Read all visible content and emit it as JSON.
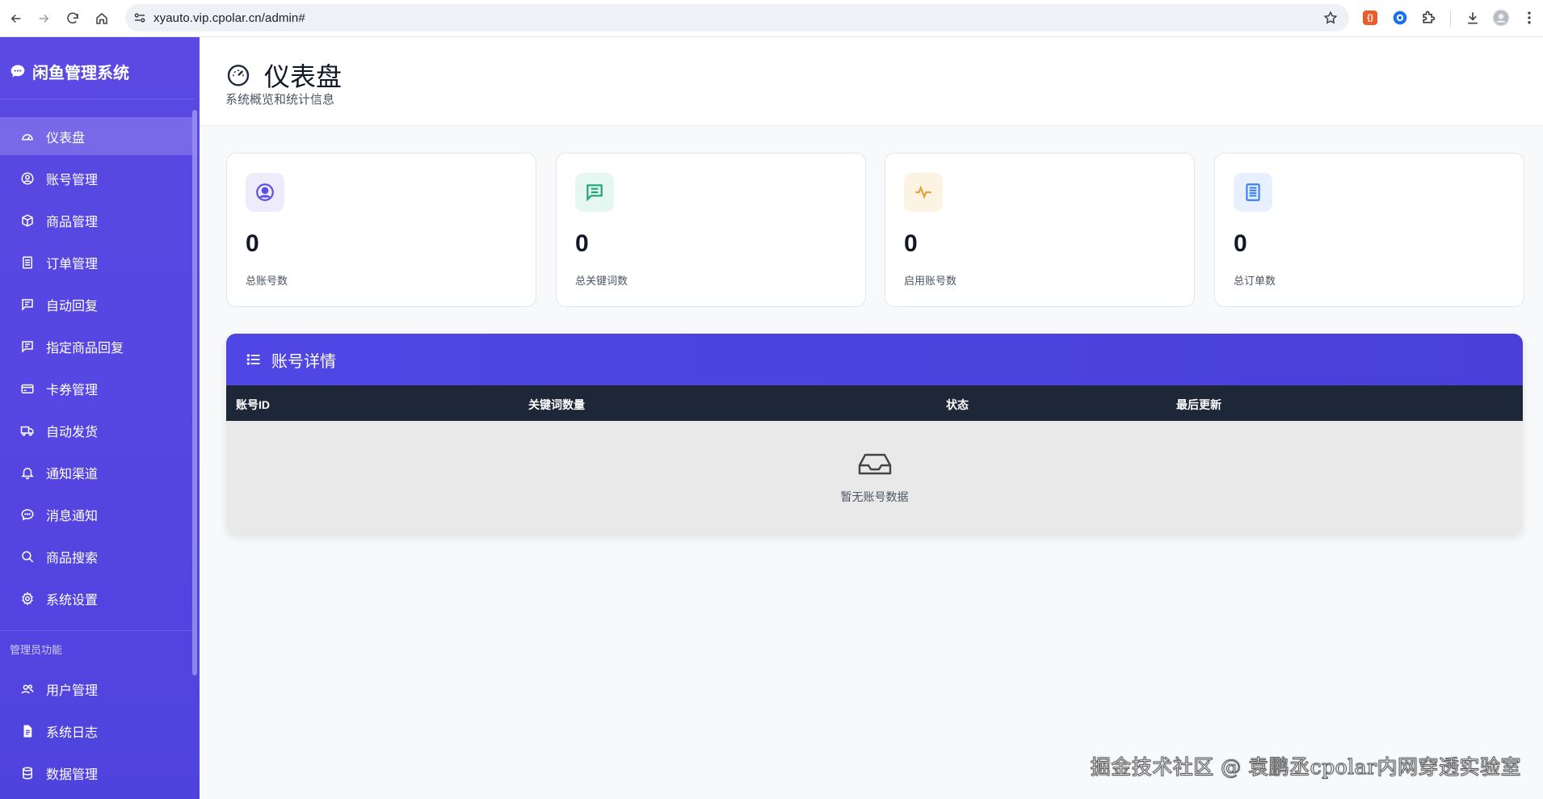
{
  "browser": {
    "url": "xyauto.vip.cpolar.cn/admin#",
    "icons": [
      "back-icon",
      "forward-icon",
      "reload-icon",
      "home-icon",
      "site-info-icon",
      "bookmark-star-icon",
      "extension-icon",
      "puzzle-icon",
      "download-icon",
      "profile-avatar",
      "menu-icon"
    ]
  },
  "sidebar": {
    "brand": "闲鱼管理系统",
    "items": [
      {
        "label": "仪表盘",
        "icon": "dashboard-icon",
        "active": true
      },
      {
        "label": "账号管理",
        "icon": "user-circle-icon"
      },
      {
        "label": "商品管理",
        "icon": "box-icon"
      },
      {
        "label": "订单管理",
        "icon": "list-icon"
      },
      {
        "label": "自动回复",
        "icon": "chat-icon"
      },
      {
        "label": "指定商品回复",
        "icon": "chat-icon"
      },
      {
        "label": "卡券管理",
        "icon": "card-icon"
      },
      {
        "label": "自动发货",
        "icon": "truck-icon"
      },
      {
        "label": "通知渠道",
        "icon": "bell-icon"
      },
      {
        "label": "消息通知",
        "icon": "message-dots-icon"
      },
      {
        "label": "商品搜索",
        "icon": "search-icon"
      },
      {
        "label": "系统设置",
        "icon": "gear-icon"
      }
    ],
    "admin_section_title": "管理员功能",
    "admin_items": [
      {
        "label": "用户管理",
        "icon": "users-icon"
      },
      {
        "label": "系统日志",
        "icon": "file-icon"
      },
      {
        "label": "数据管理",
        "icon": "database-icon"
      }
    ]
  },
  "header": {
    "title": "仪表盘",
    "subtitle": "系统概览和统计信息"
  },
  "stats": [
    {
      "value": "0",
      "label": "总账号数",
      "icon": "user-circle-icon",
      "color": "#5b4ee0",
      "bg": "#eeecfb"
    },
    {
      "value": "0",
      "label": "总关键词数",
      "icon": "chat-lines-icon",
      "color": "#1fa57a",
      "bg": "#e6f6f0"
    },
    {
      "value": "0",
      "label": "启用账号数",
      "icon": "pulse-icon",
      "color": "#e8a23a",
      "bg": "#fdf3e3"
    },
    {
      "value": "0",
      "label": "总订单数",
      "icon": "document-list-icon",
      "color": "#3b82f6",
      "bg": "#e8f0fd"
    }
  ],
  "details": {
    "title": "账号详情",
    "columns": [
      "账号ID",
      "关键词数量",
      "状态",
      "最后更新"
    ],
    "empty_text": "暂无账号数据"
  },
  "watermark": "掘金技术社区 @ 袁鹏丞cpolar内网穿透实验室",
  "colors": {
    "sidebar": "#5646e2",
    "accent": "#4f46e5",
    "table_header": "#1e2737"
  }
}
